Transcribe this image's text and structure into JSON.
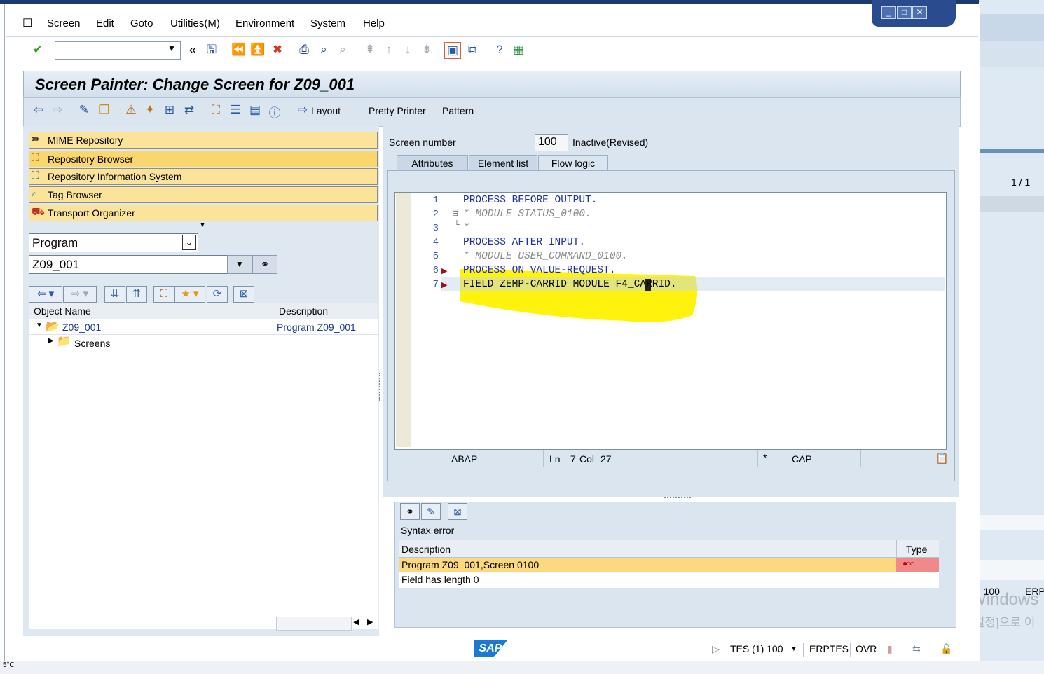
{
  "menu": {
    "items": [
      "Screen",
      "Edit",
      "Goto",
      "Utilities(M)",
      "Environment",
      "System",
      "Help"
    ]
  },
  "toolbar": {
    "command_field_value": "",
    "collapse_glyph": "«"
  },
  "title": "Screen Painter: Change Screen for Z09_001",
  "app_toolbar": {
    "layout_label": "Layout",
    "pretty_printer_label": "Pretty Printer",
    "pattern_label": "Pattern"
  },
  "left_nav": {
    "buttons": [
      "MIME Repository",
      "Repository Browser",
      "Repository Information System",
      "Tag Browser",
      "Transport Organizer"
    ],
    "object_type": "Program",
    "object_name": "Z09_001"
  },
  "tree": {
    "col_object_name": "Object Name",
    "col_description": "Description",
    "rows": [
      {
        "name": "Z09_001",
        "description": "Program Z09_001"
      },
      {
        "name": "Screens",
        "description": ""
      }
    ]
  },
  "screen": {
    "number_label": "Screen number",
    "number": "100",
    "status": "Inactive(Revised)",
    "tabs": [
      "Attributes",
      "Element list",
      "Flow logic"
    ],
    "active_tab": "Flow logic"
  },
  "code": {
    "lines": [
      {
        "no": "1",
        "text": "PROCESS BEFORE OUTPUT."
      },
      {
        "no": "2",
        "text": "* MODULE STATUS_0100."
      },
      {
        "no": "3",
        "text": "*"
      },
      {
        "no": "4",
        "text": "PROCESS AFTER INPUT."
      },
      {
        "no": "5",
        "text": "* MODULE USER_COMMAND_0100."
      },
      {
        "no": "6",
        "text": "PROCESS ON VALUE-REQUEST."
      },
      {
        "no": "7",
        "text": "FIELD ZEMP-CARRID MODULE F4_CARRID."
      }
    ],
    "highlight_color": "#fff200"
  },
  "editor_status": {
    "language": "ABAP",
    "ln_label": "Ln",
    "ln": "7",
    "col_label": "Col",
    "col": "27",
    "modified": "*",
    "caps": "CAP"
  },
  "error_panel": {
    "title": "Syntax error",
    "col_description": "Description",
    "col_type": "Type",
    "rows": [
      {
        "description": "Program Z09_001,Screen 0100"
      },
      {
        "description": "Field  has length 0"
      }
    ],
    "error_color": "#f08a8a",
    "row_highlight_color": "#fcd980"
  },
  "statusbar": {
    "logo": "SAP",
    "system": "TES (1) 100",
    "server": "ERPTES",
    "mode": "OVR"
  },
  "background_window": {
    "page_info": "1  /  1",
    "client": ") 100",
    "server": "ERP",
    "watermark1": "Windows",
    "watermark2": "[설정]으로 이"
  },
  "taskbar": {
    "temp": "5°C"
  }
}
